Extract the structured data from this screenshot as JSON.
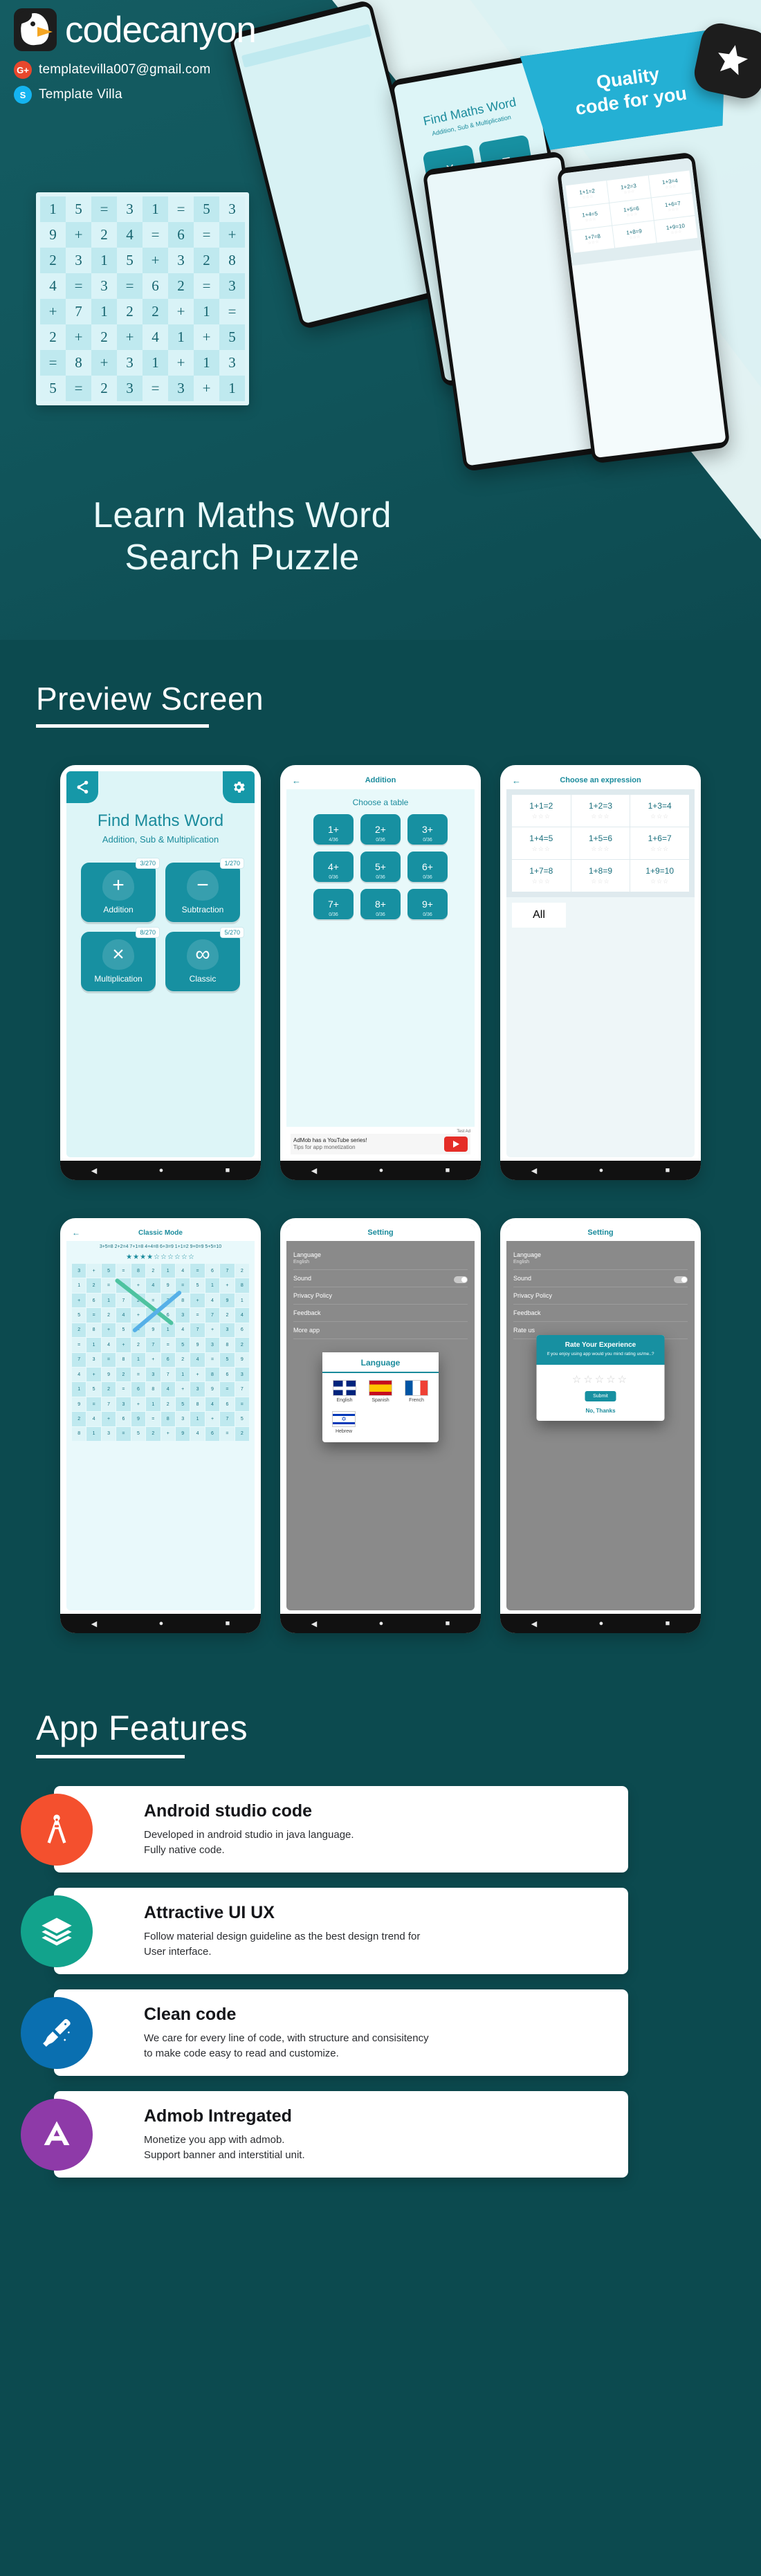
{
  "brand": {
    "name": "codecanyon",
    "logo_icon": "codecanyon-bird-logo",
    "contacts": [
      {
        "icon": "google-plus-icon",
        "icon_label": "G+",
        "text": "templatevilla007@gmail.com"
      },
      {
        "icon": "skype-icon",
        "icon_label": "S",
        "text": "Template Villa"
      }
    ]
  },
  "hero": {
    "title_line1": "Learn Maths Word",
    "title_line2": "Search Puzzle",
    "quality_badge_line1": "Quality",
    "quality_badge_line2": "code for you",
    "star_badge_icon": "star-badge-icon",
    "board": {
      "rows": [
        [
          "1",
          "5",
          "=",
          "3",
          "1",
          "=",
          "5",
          "3"
        ],
        [
          "9",
          "+",
          "2",
          "4",
          "=",
          "6",
          "=",
          "+"
        ],
        [
          "2",
          "3",
          "1",
          "5",
          "+",
          "3",
          "2",
          "8"
        ],
        [
          "4",
          "=",
          "3",
          "=",
          "6",
          "2",
          "=",
          "3"
        ],
        [
          "+",
          "7",
          "1",
          "2",
          "2",
          "+",
          "1",
          "="
        ],
        [
          "2",
          "+",
          "2",
          "+",
          "4",
          "1",
          "+",
          "5"
        ],
        [
          "=",
          "8",
          "+",
          "3",
          "1",
          "+",
          "1",
          "3"
        ],
        [
          "5",
          "=",
          "2",
          "3",
          "=",
          "3",
          "+",
          "1"
        ]
      ],
      "highlights": [
        {
          "name": "pink-diagonal",
          "color": "#e9b7d8"
        },
        {
          "name": "olive-diagonal",
          "color": "#b5b451"
        },
        {
          "name": "green-vertical",
          "color": "#42b262"
        }
      ]
    }
  },
  "preview": {
    "heading": "Preview Screen",
    "screens": {
      "home": {
        "share_icon": "share-icon",
        "gear_icon": "gear-icon",
        "title": "Find Maths Word",
        "subtitle": "Addition, Sub & Multiplication",
        "tiles": [
          {
            "label": "Addition",
            "glyph": "+",
            "badge": "3/270"
          },
          {
            "label": "Subtraction",
            "glyph": "−",
            "badge": "1/270"
          },
          {
            "label": "Multiplication",
            "glyph": "×",
            "badge": "8/270"
          },
          {
            "label": "Classic",
            "glyph": "∞",
            "badge": "5/270"
          }
        ]
      },
      "table": {
        "back_icon": "back-arrow-icon",
        "title": "Addition",
        "caption": "Choose a table",
        "cells": [
          {
            "n": "1+",
            "frac": "4/36"
          },
          {
            "n": "2+",
            "frac": "0/36"
          },
          {
            "n": "3+",
            "frac": "0/36"
          },
          {
            "n": "4+",
            "frac": "0/36"
          },
          {
            "n": "5+",
            "frac": "0/36"
          },
          {
            "n": "6+",
            "frac": "0/36"
          },
          {
            "n": "7+",
            "frac": "0/36"
          },
          {
            "n": "8+",
            "frac": "0/36"
          },
          {
            "n": "9+",
            "frac": "0/36"
          }
        ],
        "ad": {
          "tag": "Test Ad",
          "text": "AdMob has a YouTube series!",
          "subtext": "Tips for app monetization",
          "button_icon": "youtube-play-icon"
        }
      },
      "expression": {
        "back_icon": "back-arrow-icon",
        "title": "Choose an expression",
        "items": [
          {
            "e": "1+1=2",
            "stars": "☆☆☆"
          },
          {
            "e": "1+2=3",
            "stars": "☆☆☆"
          },
          {
            "e": "1+3=4",
            "stars": "☆☆☆"
          },
          {
            "e": "1+4=5",
            "stars": "☆☆☆"
          },
          {
            "e": "1+5=6",
            "stars": "☆☆☆"
          },
          {
            "e": "1+6=7",
            "stars": "☆☆☆"
          },
          {
            "e": "1+7=8",
            "stars": "☆☆☆"
          },
          {
            "e": "1+8=9",
            "stars": "☆☆☆"
          },
          {
            "e": "1+9=10",
            "stars": "☆☆☆"
          }
        ],
        "all_label": "All"
      },
      "classic": {
        "back_icon": "back-arrow-icon",
        "title": "Classic Mode",
        "words": "3+5=8  2+2=4  7+1=8  4+4=8  6+3=9  1+1=2  9+0=9  5+5=10",
        "stars": "★★★★☆☆☆☆☆☆",
        "rows": [
          [
            "3",
            "+",
            "5",
            "=",
            "8",
            "2",
            "1",
            "4",
            "=",
            "6",
            "7",
            "2"
          ],
          [
            "1",
            "2",
            "=",
            "3",
            "+",
            "4",
            "9",
            "=",
            "5",
            "1",
            "+",
            "8"
          ],
          [
            "+",
            "6",
            "1",
            "7",
            "2",
            "=",
            "3",
            "8",
            "+",
            "4",
            "9",
            "1"
          ],
          [
            "5",
            "=",
            "2",
            "4",
            "+",
            "1",
            "6",
            "3",
            "=",
            "7",
            "2",
            "4"
          ],
          [
            "2",
            "8",
            "+",
            "5",
            "=",
            "9",
            "1",
            "4",
            "7",
            "+",
            "3",
            "6"
          ],
          [
            "=",
            "1",
            "4",
            "+",
            "2",
            "7",
            "=",
            "5",
            "9",
            "3",
            "8",
            "2"
          ],
          [
            "7",
            "3",
            "=",
            "8",
            "1",
            "+",
            "6",
            "2",
            "4",
            "=",
            "5",
            "9"
          ],
          [
            "4",
            "+",
            "9",
            "2",
            "=",
            "3",
            "7",
            "1",
            "+",
            "8",
            "6",
            "3"
          ],
          [
            "1",
            "5",
            "2",
            "=",
            "6",
            "8",
            "4",
            "+",
            "3",
            "9",
            "=",
            "7"
          ],
          [
            "9",
            "=",
            "7",
            "3",
            "+",
            "1",
            "2",
            "5",
            "8",
            "4",
            "6",
            "="
          ],
          [
            "2",
            "4",
            "+",
            "6",
            "9",
            "=",
            "8",
            "3",
            "1",
            "+",
            "7",
            "5"
          ],
          [
            "8",
            "1",
            "3",
            "=",
            "5",
            "2",
            "+",
            "9",
            "4",
            "6",
            "=",
            "2"
          ]
        ]
      },
      "setting_language": {
        "title": "Setting",
        "items": [
          {
            "label": "Language",
            "sub": "English",
            "toggle": false
          },
          {
            "label": "Sound",
            "sub": "",
            "toggle": true
          },
          {
            "label": "Privacy Policy",
            "sub": "",
            "toggle": false
          },
          {
            "label": "Feedback",
            "sub": "",
            "toggle": false
          },
          {
            "label": "More app",
            "sub": "",
            "toggle": false
          }
        ],
        "dialog": {
          "title": "Language",
          "languages": [
            {
              "name": "English",
              "flag": "uk-flag-icon"
            },
            {
              "name": "Spanish",
              "flag": "spain-flag-icon"
            },
            {
              "name": "French",
              "flag": "france-flag-icon"
            },
            {
              "name": "Hebrew",
              "flag": "israel-flag-icon"
            }
          ]
        }
      },
      "setting_rate": {
        "title": "Setting",
        "items": [
          {
            "label": "Language",
            "sub": "English",
            "toggle": false
          },
          {
            "label": "Sound",
            "sub": "",
            "toggle": true
          },
          {
            "label": "Privacy Policy",
            "sub": "",
            "toggle": false
          },
          {
            "label": "Feedback",
            "sub": "",
            "toggle": false
          },
          {
            "label": "Rate us",
            "sub": "",
            "toggle": false
          }
        ],
        "dialog": {
          "title": "Rate Your Experience",
          "subtitle": "If you enjoy using app would you mind rating us/me..?",
          "stars": "☆☆☆☆☆",
          "submit": "Submit",
          "dismiss": "No, Thanks"
        }
      }
    },
    "nav_icons": [
      "back-triangle-icon",
      "home-circle-icon",
      "recents-square-icon"
    ]
  },
  "features": {
    "heading": "App Features",
    "cards": [
      {
        "title": "Android studio code",
        "desc_line1": "Developed in android studio in java language.",
        "desc_line2": "Fully native code.",
        "icon": "android-studio-compass-icon",
        "color": "#f4502e"
      },
      {
        "title": "Attractive UI UX",
        "desc_line1": "Follow material design guideline as the best design trend  for",
        "desc_line2": "User interface.",
        "icon": "layers-stack-icon",
        "color": "#12a38c"
      },
      {
        "title": "Clean code",
        "desc_line1": "We care for every line of code, with structure and consisitency",
        "desc_line2": "to make code easy to read and customize.",
        "icon": "broom-clean-icon",
        "color": "#0a6fb0"
      },
      {
        "title": "Admob Intregated",
        "desc_line1": "Monetize you app with admob.",
        "desc_line2": "Support banner and interstitial unit.",
        "icon": "admob-icon",
        "color": "#8e3aa8"
      }
    ]
  },
  "colors": {
    "bg_dark": "#0c4a4f",
    "teal": "#1790a1",
    "light_teal": "#ddf5f7",
    "white": "#ffffff"
  }
}
